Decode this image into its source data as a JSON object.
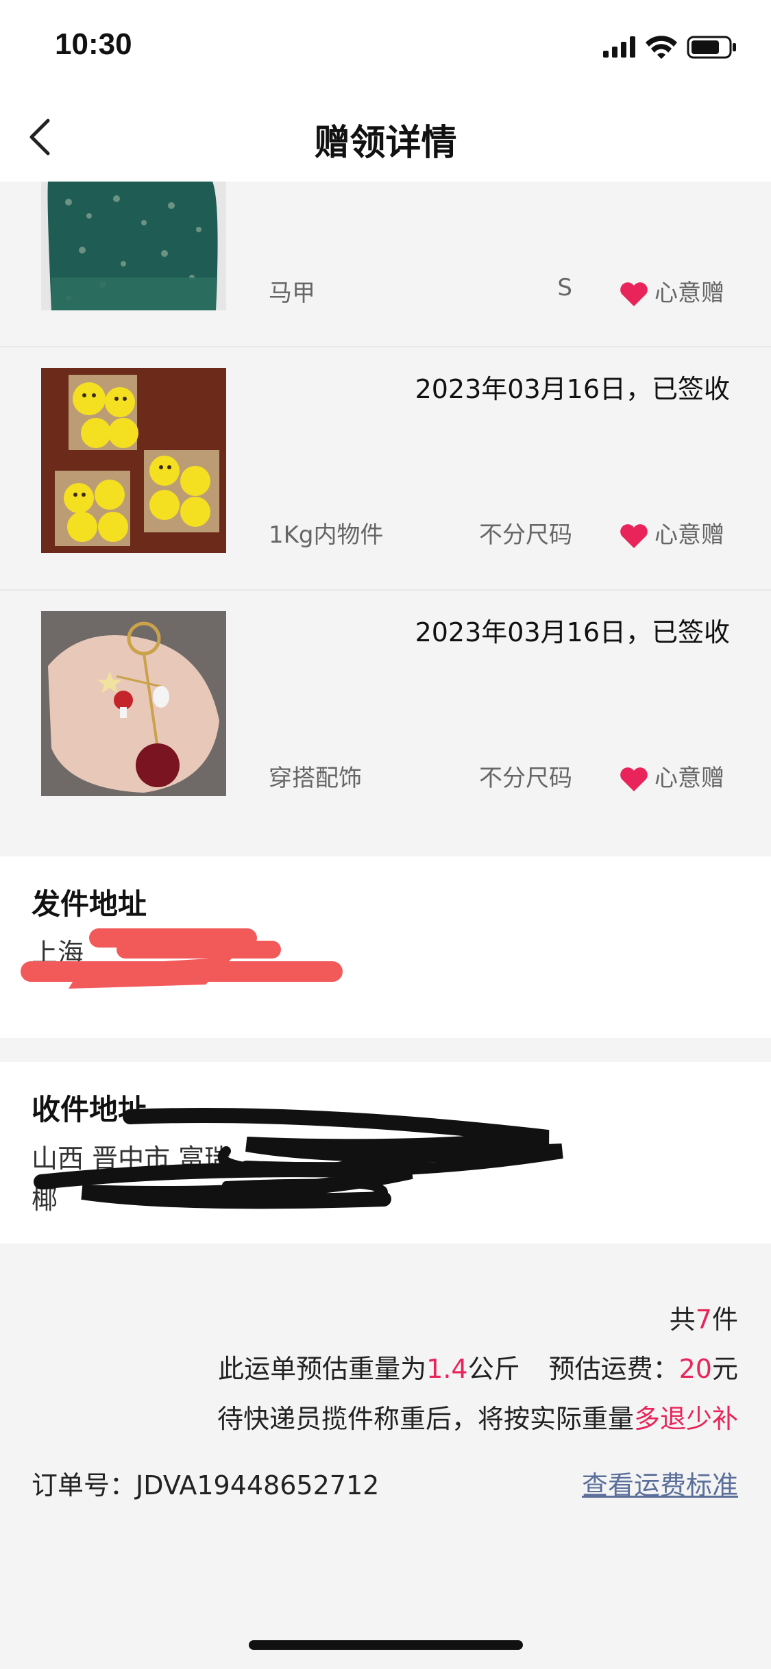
{
  "status": {
    "time": "10:30"
  },
  "nav": {
    "title": "赠领详情"
  },
  "items": [
    {
      "name": "马甲",
      "size": "S",
      "tag": "心意赠",
      "date": ""
    },
    {
      "name": "1Kg内物件",
      "size": "不分尺码",
      "tag": "心意赠",
      "date": "2023年03月16日，已签收"
    },
    {
      "name": "穿搭配饰",
      "size": "不分尺码",
      "tag": "心意赠",
      "date": "2023年03月16日，已签收"
    }
  ],
  "sender": {
    "title": "发件地址",
    "line1": "上海",
    "line2": ""
  },
  "receiver": {
    "title": "收件地址",
    "line1": "山西 晋中市 富瑞",
    "line2": "椰"
  },
  "summary": {
    "count_prefix": "共",
    "count": "7",
    "count_suffix": "件",
    "weight_prefix": "此运单预估重量为",
    "weight": "1.4",
    "weight_unit": "公斤",
    "fee_prefix": "预估运费：",
    "fee": "20",
    "fee_unit": "元",
    "note_prefix": "待快递员揽件称重后，将按实际重量",
    "note_accent": "多退少补",
    "order_label": "订单号：",
    "order_no": "JDVA19448652712",
    "fee_link": "查看运费标准"
  },
  "colors": {
    "accent": "#e8245a",
    "heart": "#e8245a",
    "link": "#5b6f9a"
  }
}
